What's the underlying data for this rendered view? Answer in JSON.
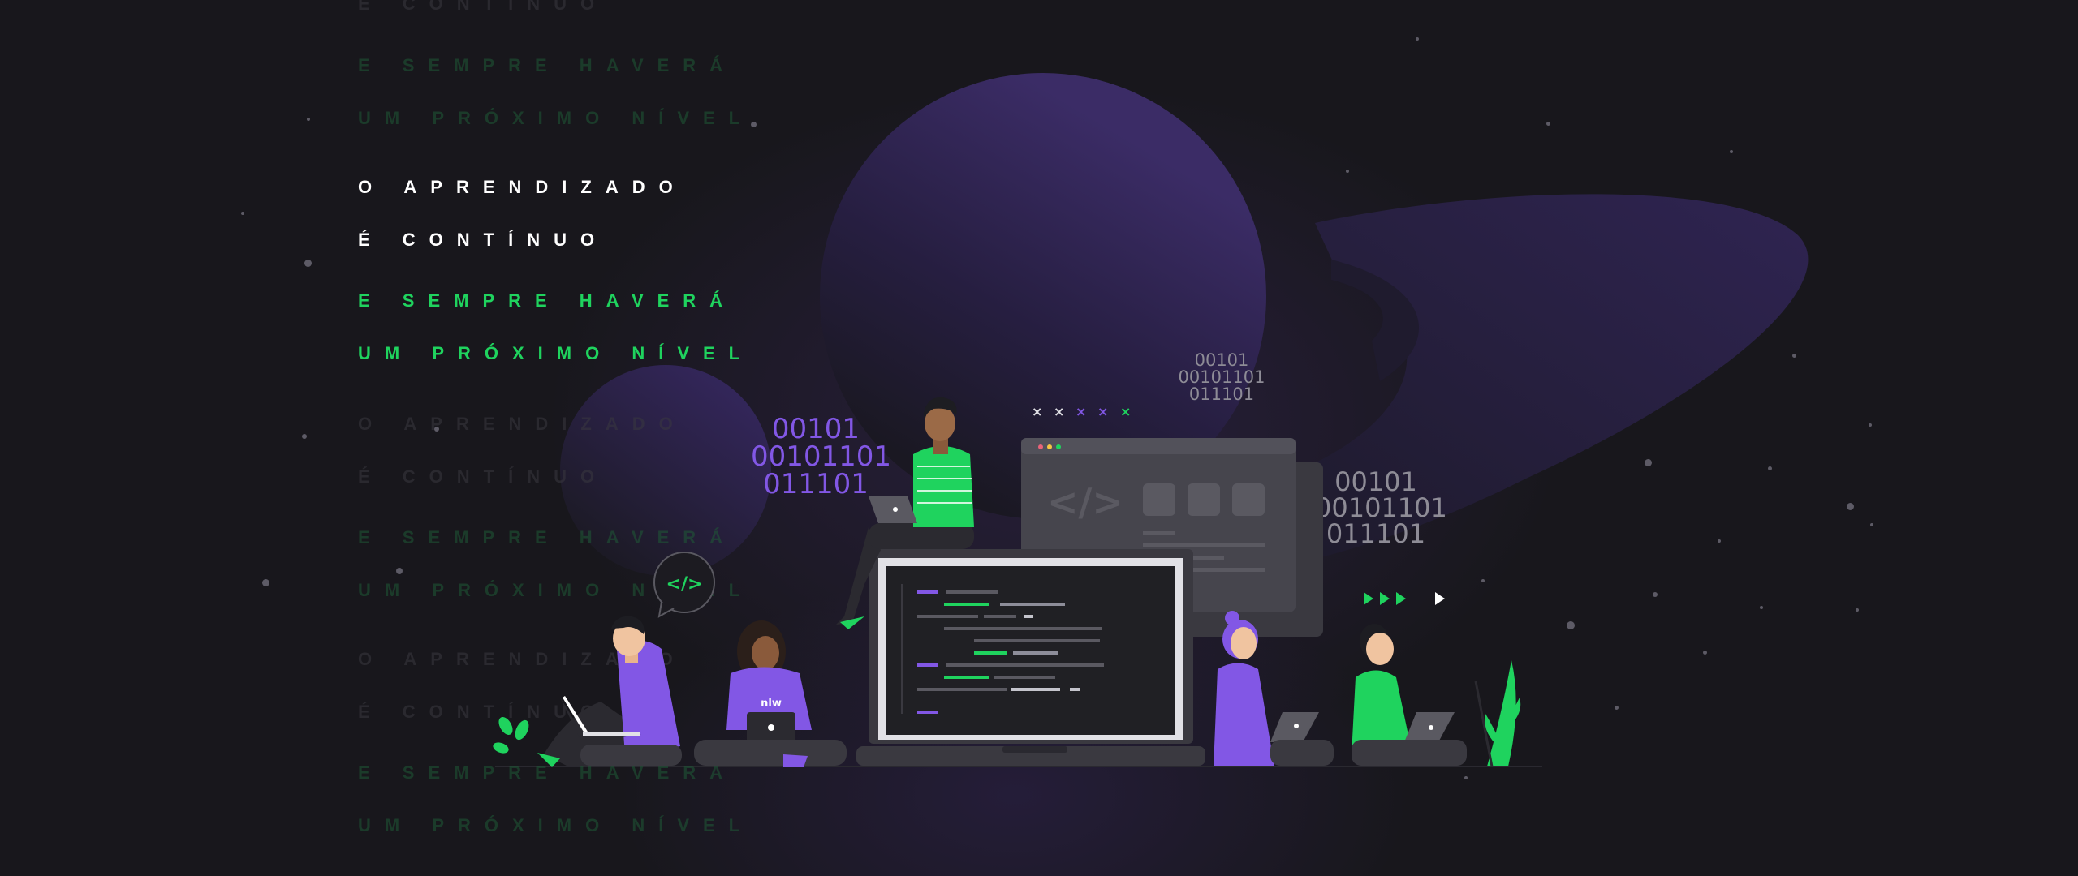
{
  "headline": {
    "line1": "O APRENDIZADO",
    "line2": "É CONTÍNUO",
    "line3": "E SEMPRE HAVERÁ",
    "line4": "UM PRÓXIMO NÍVEL"
  },
  "echo_lines": {
    "top": [
      "É CONTÍNUO",
      "E SEMPRE HAVERÁ",
      "UM PRÓXIMO NÍVEL"
    ],
    "middle": [
      "O APRENDIZADO",
      "É CONTÍNUO",
      "E SEMPRE HAVERÁ",
      "UM PRÓXIMO NÍVEL"
    ],
    "bottom": [
      "O APRENDIZADO",
      "É CONTÍNUO",
      "E SEMPRE HAVERÁ",
      "UM PRÓXIMO NÍVEL"
    ]
  },
  "binary": {
    "purple": "00101\n00101101\n011101",
    "top_right": "00101\n00101101\n011101",
    "right": "00101\n00101101\n011101"
  },
  "code_bubble": "</>",
  "window_code_tag": "</>",
  "shirt_logo": "nlw",
  "colors": {
    "background": "#18171c",
    "planet": "#3a2d63",
    "green": "#1fd35e",
    "purple": "#8257e5",
    "text_white": "#ffffff"
  }
}
